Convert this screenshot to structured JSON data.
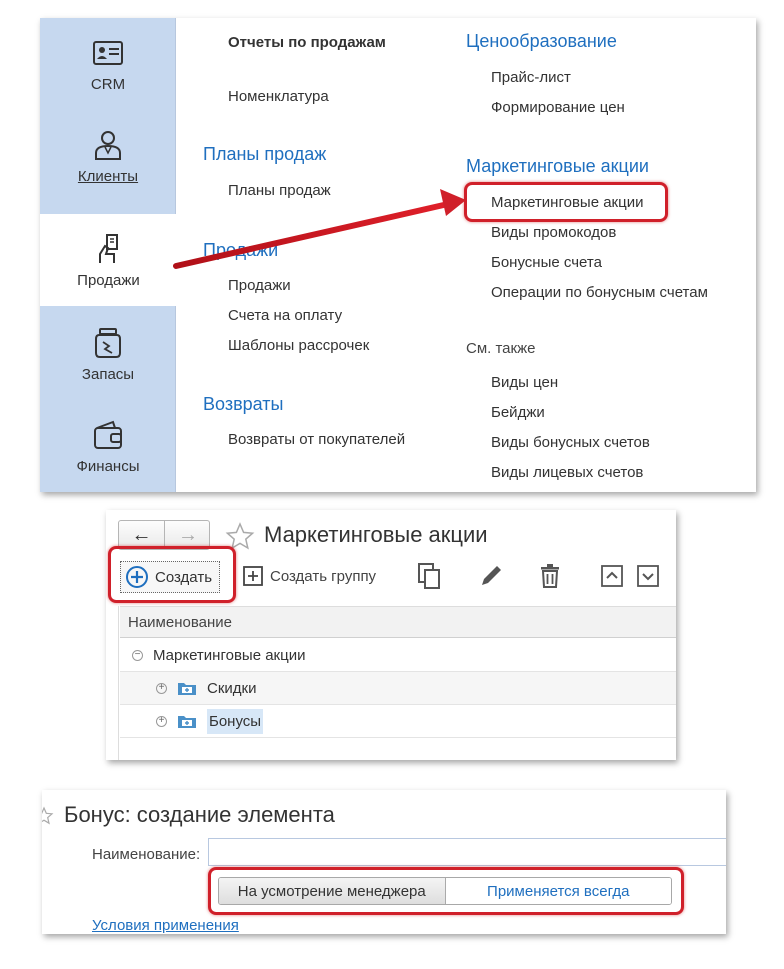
{
  "sections": [
    {
      "label": "CRM",
      "icon": "id-card-icon"
    },
    {
      "label": "Клиенты",
      "icon": "customer-icon"
    },
    {
      "label": "Продажи",
      "icon": "sales-hand-icon"
    },
    {
      "label": "Запасы",
      "icon": "stock-jar-icon"
    },
    {
      "label": "Финансы",
      "icon": "wallet-icon"
    }
  ],
  "active_section": "Продажи",
  "menu": {
    "col1": {
      "reports": "Отчеты по продажам",
      "nomenclature": "Номенклатура",
      "plans_group": "Планы продаж",
      "plans_item": "Планы продаж",
      "sales_group": "Продажи",
      "sales_items": [
        "Продажи",
        "Счета на оплату",
        "Шаблоны рассрочек"
      ],
      "returns_group": "Возвраты",
      "returns_items": [
        "Возвраты от покупателей"
      ]
    },
    "col2": {
      "pricing_group": "Ценообразование",
      "pricing_items": [
        "Прайс-лист",
        "Формирование цен"
      ],
      "marketing_group": "Маркетинговые акции",
      "marketing_items": [
        "Маркетинговые акции",
        "Виды промокодов",
        "Бонусные счета",
        "Операции по бонусным счетам"
      ],
      "see_also": "См. также",
      "see_also_items": [
        "Виды цен",
        "Бейджи",
        "Виды бонусных счетов",
        "Виды лицевых счетов"
      ]
    }
  },
  "list_form": {
    "title": "Маркетинговые акции",
    "nav_back": "←",
    "nav_forward": "→",
    "toolbar": {
      "create": "Создать",
      "create_group": "Создать группу"
    },
    "column_header": "Наименование",
    "rows": [
      {
        "label": "Маркетинговые акции",
        "toggle": "⊖"
      },
      {
        "label": "Скидки",
        "toggle": "⊕"
      },
      {
        "label": "Бонусы",
        "toggle": "⊕"
      }
    ]
  },
  "element_form": {
    "title": "Бонус: создание элемента",
    "name_label": "Наименование:",
    "name_value": "",
    "options": [
      "На усмотрение менеджера",
      "Применяется всегда"
    ],
    "conditions_link": "Условия применения"
  },
  "colors": {
    "accent_blue": "#1f6fbf",
    "sidebar": "#c6d8ef",
    "highlight_red": "#d0202a"
  }
}
